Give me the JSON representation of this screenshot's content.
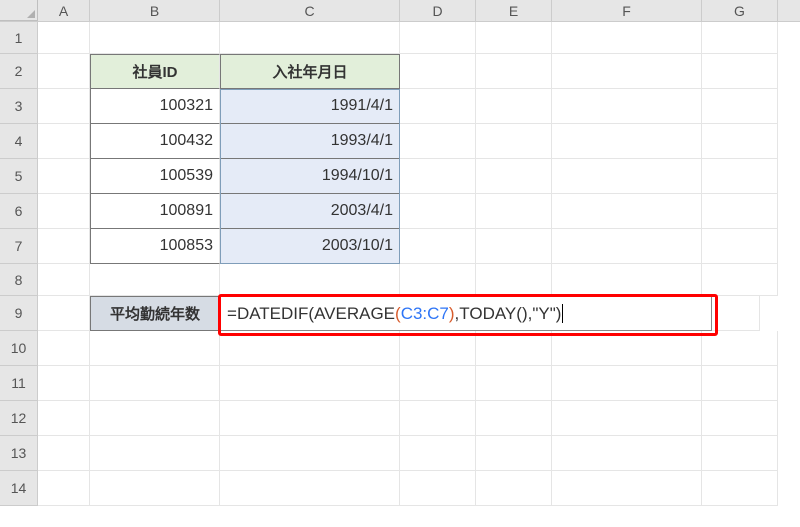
{
  "columns": [
    "A",
    "B",
    "C",
    "D",
    "E",
    "F",
    "G"
  ],
  "rows": [
    "1",
    "2",
    "3",
    "4",
    "5",
    "6",
    "7",
    "8",
    "9",
    "10",
    "11",
    "12",
    "13",
    "14"
  ],
  "table": {
    "header_b": "社員ID",
    "header_c": "入社年月日",
    "data": [
      {
        "id": "100321",
        "date": "1991/4/1"
      },
      {
        "id": "100432",
        "date": "1993/4/1"
      },
      {
        "id": "100539",
        "date": "1994/10/1"
      },
      {
        "id": "100891",
        "date": "2003/4/1"
      },
      {
        "id": "100853",
        "date": "2003/10/1"
      }
    ]
  },
  "summary": {
    "label": "平均勤続年数",
    "formula_tokens": {
      "eq": "=",
      "fn1": "DATEDIF",
      "lp1": "(",
      "fn2": "AVERAGE",
      "lp2": "(",
      "ref": "C3:C7",
      "rp2": ")",
      "comma1": ",",
      "fn3": "TODAY",
      "lp3": "(",
      "rp3": ")",
      "comma2": ",",
      "str": "\"Y\"",
      "rp1": ")"
    }
  },
  "chart_data": {
    "type": "table",
    "columns": [
      "社員ID",
      "入社年月日"
    ],
    "rows": [
      [
        "100321",
        "1991/4/1"
      ],
      [
        "100432",
        "1993/4/1"
      ],
      [
        "100539",
        "1994/10/1"
      ],
      [
        "100891",
        "2003/4/1"
      ],
      [
        "100853",
        "2003/10/1"
      ]
    ],
    "summary_label": "平均勤続年数",
    "summary_formula": "=DATEDIF(AVERAGE(C3:C7),TODAY(),\"Y\")"
  }
}
